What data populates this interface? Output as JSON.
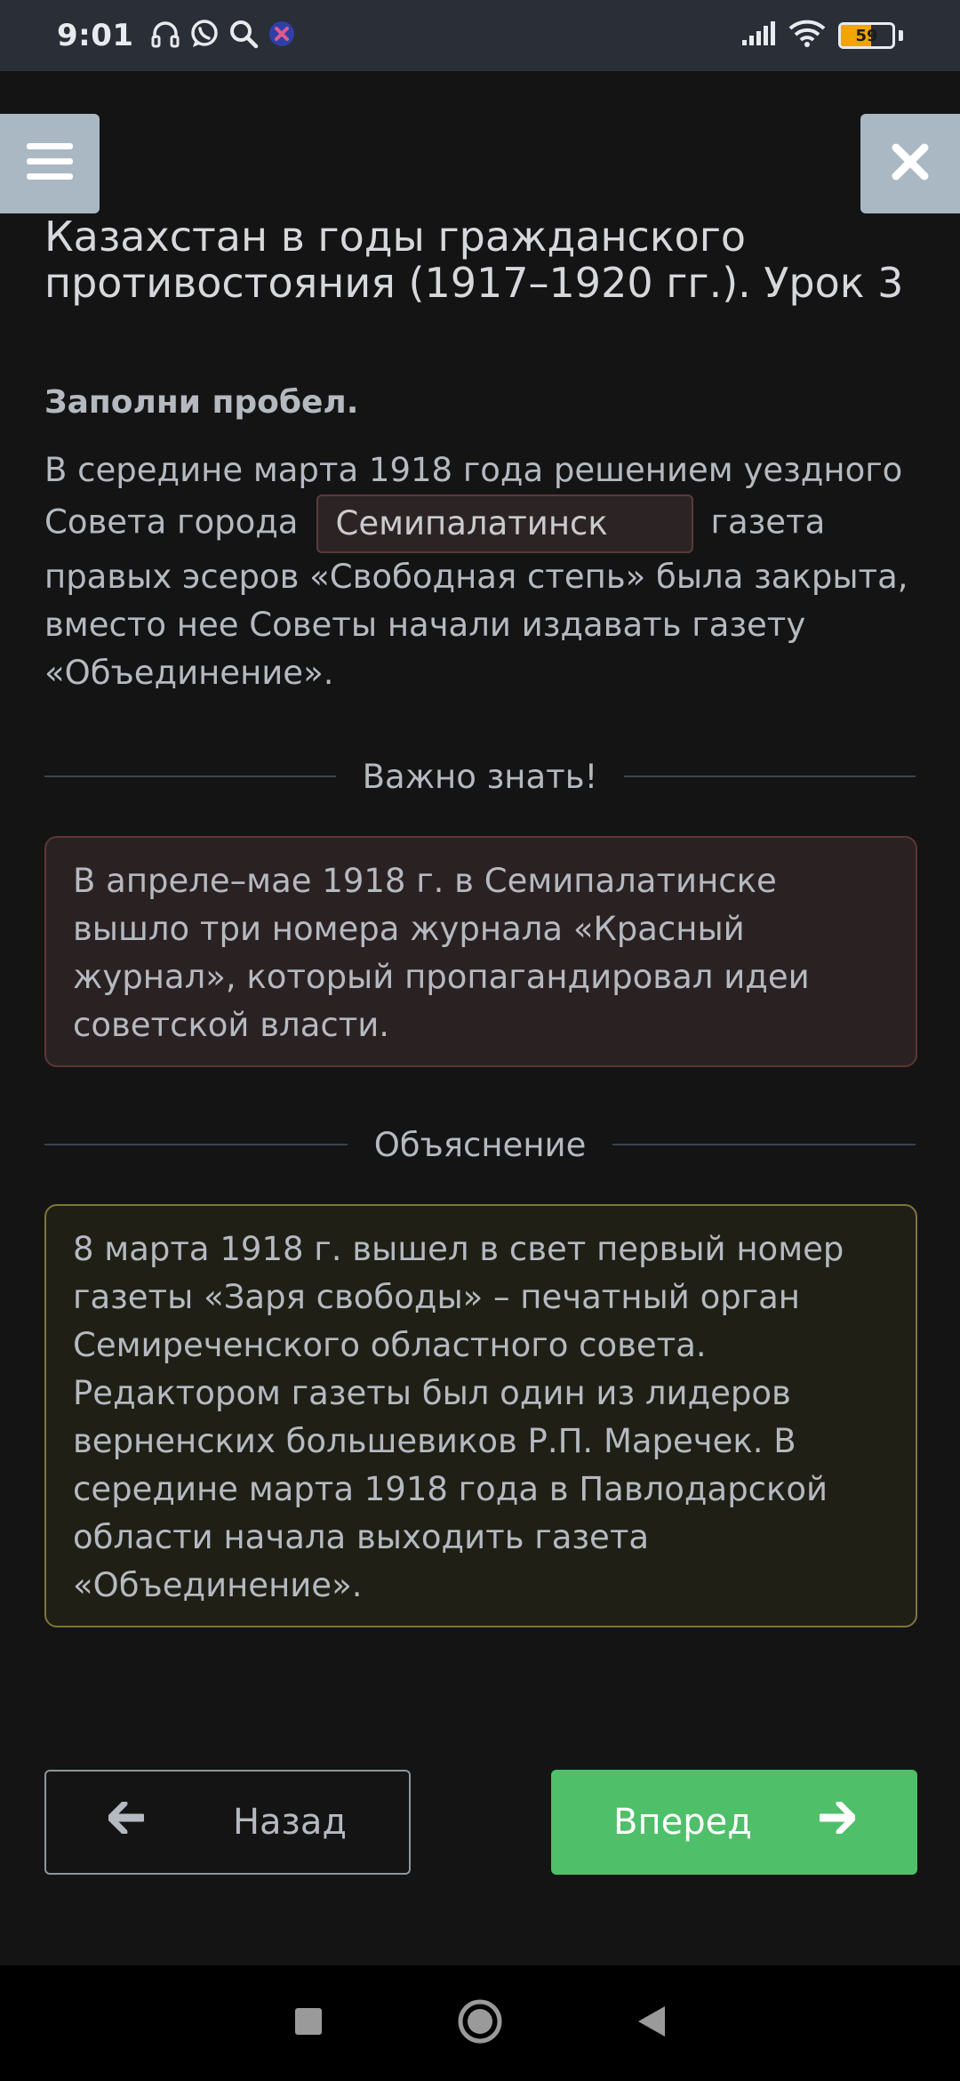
{
  "status_bar": {
    "time": "9:01",
    "battery_level": "59",
    "battery_fill_fraction": 0.59,
    "battery_color": "#f0a500",
    "left_icons": [
      "headphones-icon",
      "whatsapp-icon",
      "search-icon",
      "app-badge-icon"
    ],
    "right_icons": [
      "signal-icon",
      "wifi-icon",
      "battery-icon"
    ]
  },
  "header": {
    "menu_icon": "hamburger-menu-icon",
    "close_icon": "close-icon",
    "title": "Казахстан в годы гражданского противостояния (1917–1920 гг.). Урок 3"
  },
  "task": {
    "label": "Заполни пробел.",
    "text_before": "В середине марта 1918 года решением уездного Совета города",
    "answer": "Семипалатинск",
    "text_after": "газета правых эсеров «Свободная степь» была закрыта, вместо нее Советы начали издавать газету «Объединение»."
  },
  "important": {
    "heading": "Важно знать!",
    "text": "В апреле–мае 1918 г. в Семипалатинске вышло три номера журнала «Красный журнал», который пропагандировал идеи советской власти."
  },
  "explanation": {
    "heading": "Объяснение",
    "text": "8 марта 1918 г. вышел в свет первый номер газеты «Заря свободы» – печатный орган Семиреченского областного совета. Редактором газеты был один из лидеров верненских большевиков Р.П. Маречек. В середине марта 1918 года в Павлодарской области начала выходить газета «Объединение»."
  },
  "navigation": {
    "back_label": "Назад",
    "next_label": "Вперед",
    "next_color": "#4fbf6a"
  },
  "system_nav": {
    "items": [
      "recent-apps-icon",
      "home-icon",
      "back-icon"
    ]
  }
}
